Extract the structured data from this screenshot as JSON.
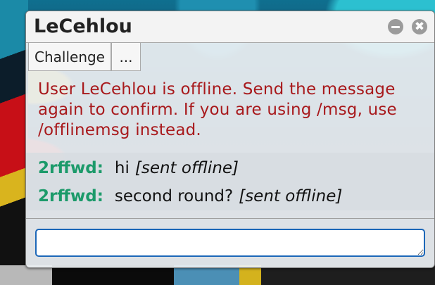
{
  "window": {
    "title": "LeCehlou",
    "minimize_label": "",
    "close_label": "✖"
  },
  "toolbar": {
    "challenge_label": "Challenge",
    "more_label": "..."
  },
  "messages": {
    "error": "User LeCehlou is offline. Send the message again to confirm. If you are using /msg, use /offlinemsg instead.",
    "chat": [
      {
        "user": "2rffwd:",
        "text": "hi",
        "tag": "[sent offline]"
      },
      {
        "user": "2rffwd:",
        "text": "second round?",
        "tag": "[sent offline]"
      }
    ]
  },
  "input": {
    "value": "",
    "placeholder": ""
  },
  "colors": {
    "error_text": "#a8191c",
    "username": "#1c9a6a",
    "input_border": "#1c67b8"
  }
}
